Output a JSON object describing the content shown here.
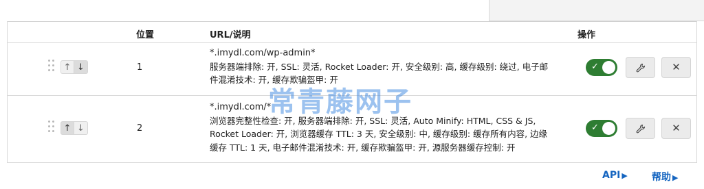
{
  "table": {
    "columns": {
      "position": "位置",
      "url": "URL/说明",
      "actions": "操作"
    },
    "rows": [
      {
        "position": "1",
        "url": "*.imydl.com/wp-admin*",
        "desc_line1": "服务器端排除: 开, SSL: 灵活, Rocket Loader: 开, 安全级别: 高, 缓存级别: 绕过, 电子邮",
        "desc_line2": "件混淆技术: 开, 缓存欺骗盔甲: 开",
        "enabled": true
      },
      {
        "position": "2",
        "url": "*.imydl.com/*",
        "desc_line1": "浏览器完整性检查: 开, 服务器端排除: 开, SSL: 灵活, Auto Minify: HTML, CSS & JS,",
        "desc_line2": "Rocket Loader: 开, 浏览器缓存 TTL: 3 天, 安全级别: 中, 缓存级别: 缓存所有内容, 边缘",
        "desc_line3": "缓存 TTL: 1 天, 电子邮件混淆技术: 开, 缓存欺骗盔甲: 开, 源服务器缓存控制: 开",
        "enabled": true
      }
    ]
  },
  "icons": {
    "up": "↑",
    "down": "↓",
    "check": "✓",
    "wrench": "🔧",
    "close": "✕"
  },
  "footer": {
    "api_label": "API",
    "help_label": "帮助"
  },
  "watermark": "常青藤网子",
  "colors": {
    "toggle_on": "#2e7d32",
    "link": "#1565c0"
  }
}
